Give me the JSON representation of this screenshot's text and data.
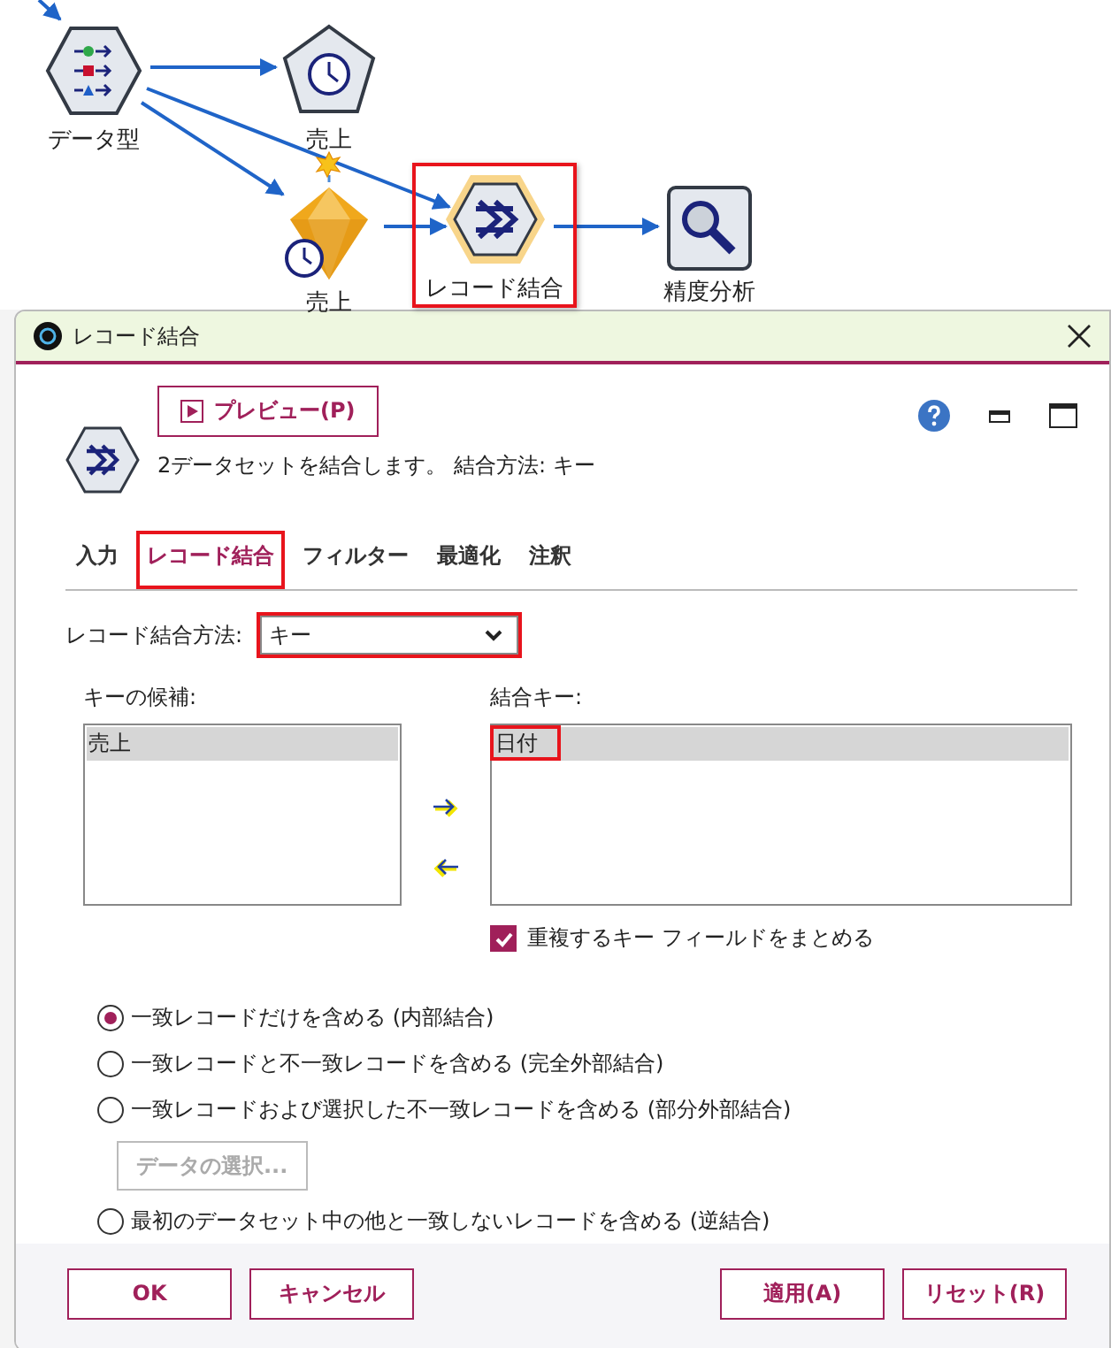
{
  "canvas": {
    "nodes": [
      {
        "label": "データ型",
        "kind": "type",
        "highlighted": false
      },
      {
        "label": "売上",
        "kind": "time_source",
        "highlighted": false
      },
      {
        "label": "売上",
        "kind": "time_gold",
        "highlighted": false
      },
      {
        "label": "レコード結合",
        "kind": "merge",
        "highlighted": true
      },
      {
        "label": "精度分析",
        "kind": "analysis",
        "highlighted": false
      }
    ]
  },
  "dialog": {
    "title": "レコード結合",
    "preview_button": "プレビュー(P)",
    "description": "2データセットを結合します。 結合方法: キー",
    "tabs": [
      {
        "label": "入力",
        "selected": false,
        "highlighted": false
      },
      {
        "label": "レコード結合",
        "selected": true,
        "highlighted": true
      },
      {
        "label": "フィルター",
        "selected": false,
        "highlighted": false
      },
      {
        "label": "最適化",
        "selected": false,
        "highlighted": false
      },
      {
        "label": "注釈",
        "selected": false,
        "highlighted": false
      }
    ],
    "merge_method": {
      "label": "レコード結合方法:",
      "value": "キー",
      "highlighted": true
    },
    "candidates": {
      "label": "キーの候補:",
      "items": [
        {
          "text": "売上",
          "selected": true,
          "highlighted": false
        }
      ]
    },
    "join_keys": {
      "label": "結合キー:",
      "items": [
        {
          "text": "日付",
          "selected": true,
          "highlighted": true
        }
      ]
    },
    "combine_duplicates": {
      "label": "重複するキー フィールドをまとめる",
      "checked": true
    },
    "options": [
      {
        "label": "一致レコードだけを含める (内部結合)",
        "selected": true
      },
      {
        "label": "一致レコードと不一致レコードを含める (完全外部結合)",
        "selected": false
      },
      {
        "label": "一致レコードおよび選択した不一致レコードを含める (部分外部結合)",
        "selected": false
      },
      {
        "label": "最初のデータセット中の他と一致しないレコードを含める (逆結合)",
        "selected": false
      }
    ],
    "select_data_button": {
      "label": "データの選択...",
      "disabled": true
    },
    "buttons_left": [
      "OK",
      "キャンセル"
    ],
    "buttons_right": [
      "適用(A)",
      "リセット(R)"
    ]
  }
}
